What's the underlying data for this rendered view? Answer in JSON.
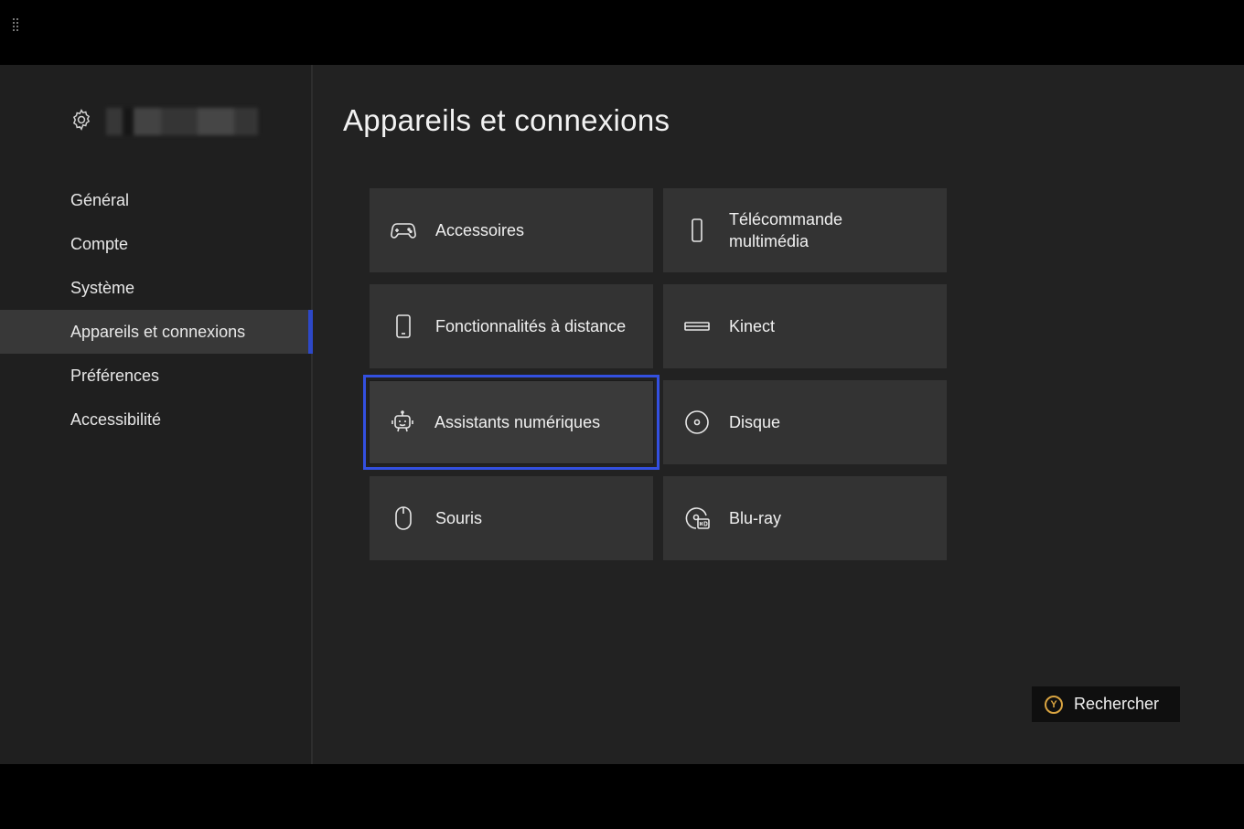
{
  "header": {
    "title": "Appareils et connexions"
  },
  "sidebar": {
    "items": [
      {
        "label": "Général"
      },
      {
        "label": "Compte"
      },
      {
        "label": "Système"
      },
      {
        "label": "Appareils et connexions",
        "selected": true
      },
      {
        "label": "Préférences"
      },
      {
        "label": "Accessibilité"
      }
    ]
  },
  "tiles": [
    {
      "label": "Accessoires",
      "icon": "gamepad-icon"
    },
    {
      "label": "Télécommande multimédia",
      "line1": "Télécommande",
      "line2": "multimédia",
      "icon": "remote-icon"
    },
    {
      "label": "Fonctionnalités à distance",
      "icon": "phone-icon"
    },
    {
      "label": "Kinect",
      "icon": "kinect-icon"
    },
    {
      "label": "Assistants numériques",
      "icon": "robot-icon",
      "focused": true
    },
    {
      "label": "Disque",
      "icon": "disc-icon"
    },
    {
      "label": "Souris",
      "icon": "mouse-icon"
    },
    {
      "label": "Blu-ray",
      "icon": "bluray-icon"
    }
  ],
  "search": {
    "button_glyph": "Y",
    "label": "Rechercher"
  },
  "colors": {
    "accent": "#2d48c8",
    "focus": "#3350e0",
    "y_button": "#d9a441"
  }
}
